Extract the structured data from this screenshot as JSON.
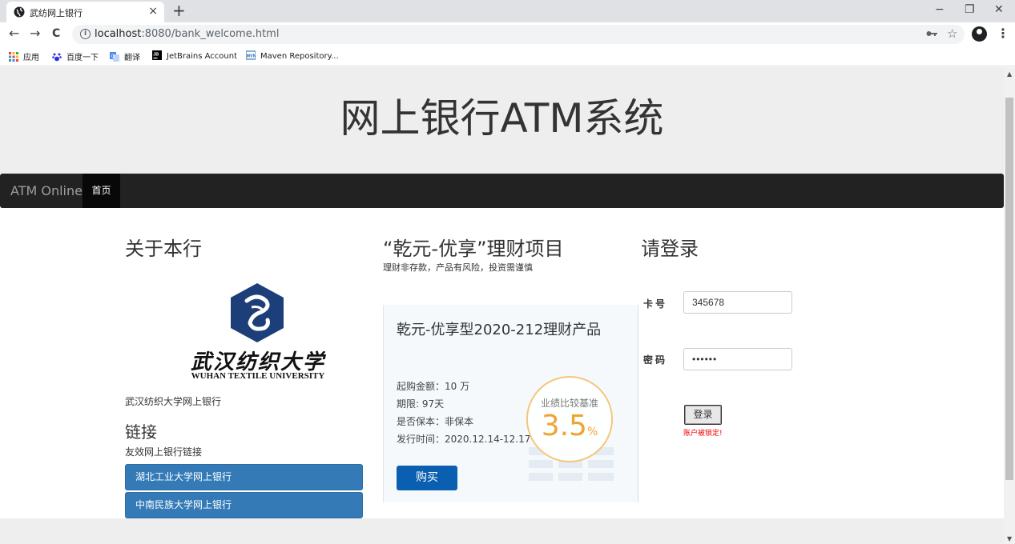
{
  "browser": {
    "tab": {
      "title": "武纺网上银行",
      "close": "×"
    },
    "new_tab": "+",
    "window_controls": {
      "minimize": "−",
      "restore": "❐",
      "close": "✕"
    },
    "nav": {
      "back": "←",
      "forward": "→",
      "reload": "C"
    },
    "url": {
      "host": "localhost",
      "rest": ":8080/bank_welcome.html"
    },
    "icons": {
      "key": "key-icon",
      "star": "☆",
      "menu": "⋮"
    },
    "bookmarks": [
      {
        "label": "应用",
        "icon": "apps-grid-icon"
      },
      {
        "label": "百度一下",
        "icon": "baidu-paw-icon"
      },
      {
        "label": "翻译",
        "icon": "translate-icon"
      },
      {
        "label": "JetBrains Account",
        "icon": "jetbrains-icon"
      },
      {
        "label": "Maven Repository...",
        "icon": "maven-icon"
      }
    ]
  },
  "page": {
    "site_title": "网上银行ATM系统",
    "navbar": {
      "brand": "ATM Online",
      "home": "首页"
    },
    "about": {
      "heading": "关于本行",
      "logo_cn": "武汉纺织大学",
      "logo_en": "WUHAN TEXTILE UNIVERSITY",
      "text": "武汉纺织大学网上银行"
    },
    "links": {
      "heading": "链接",
      "subtitle": "友效网上银行链接",
      "items": [
        "湖北工业大学网上银行",
        "中南民族大学网上银行"
      ]
    },
    "product": {
      "heading": "“乾元-优享”理财项目",
      "warning": "理财非存款，产品有风险，投资需谨慎",
      "card_title": "乾元-优享型2020-212理财产品",
      "rows": [
        "起购金额：10 万",
        "期限: 97天",
        "是否保本：非保本",
        "发行时间：2020.12.14-12.17"
      ],
      "badge_label": "业绩比较基准",
      "badge_value": "3.5",
      "badge_unit": "%",
      "buy": "购买"
    },
    "login": {
      "heading": "请登录",
      "card_label": "卡号",
      "card_value": "345678",
      "password_label": "密码",
      "password_value": "••••••",
      "submit": "登录",
      "error": "账户被锁定!"
    }
  }
}
